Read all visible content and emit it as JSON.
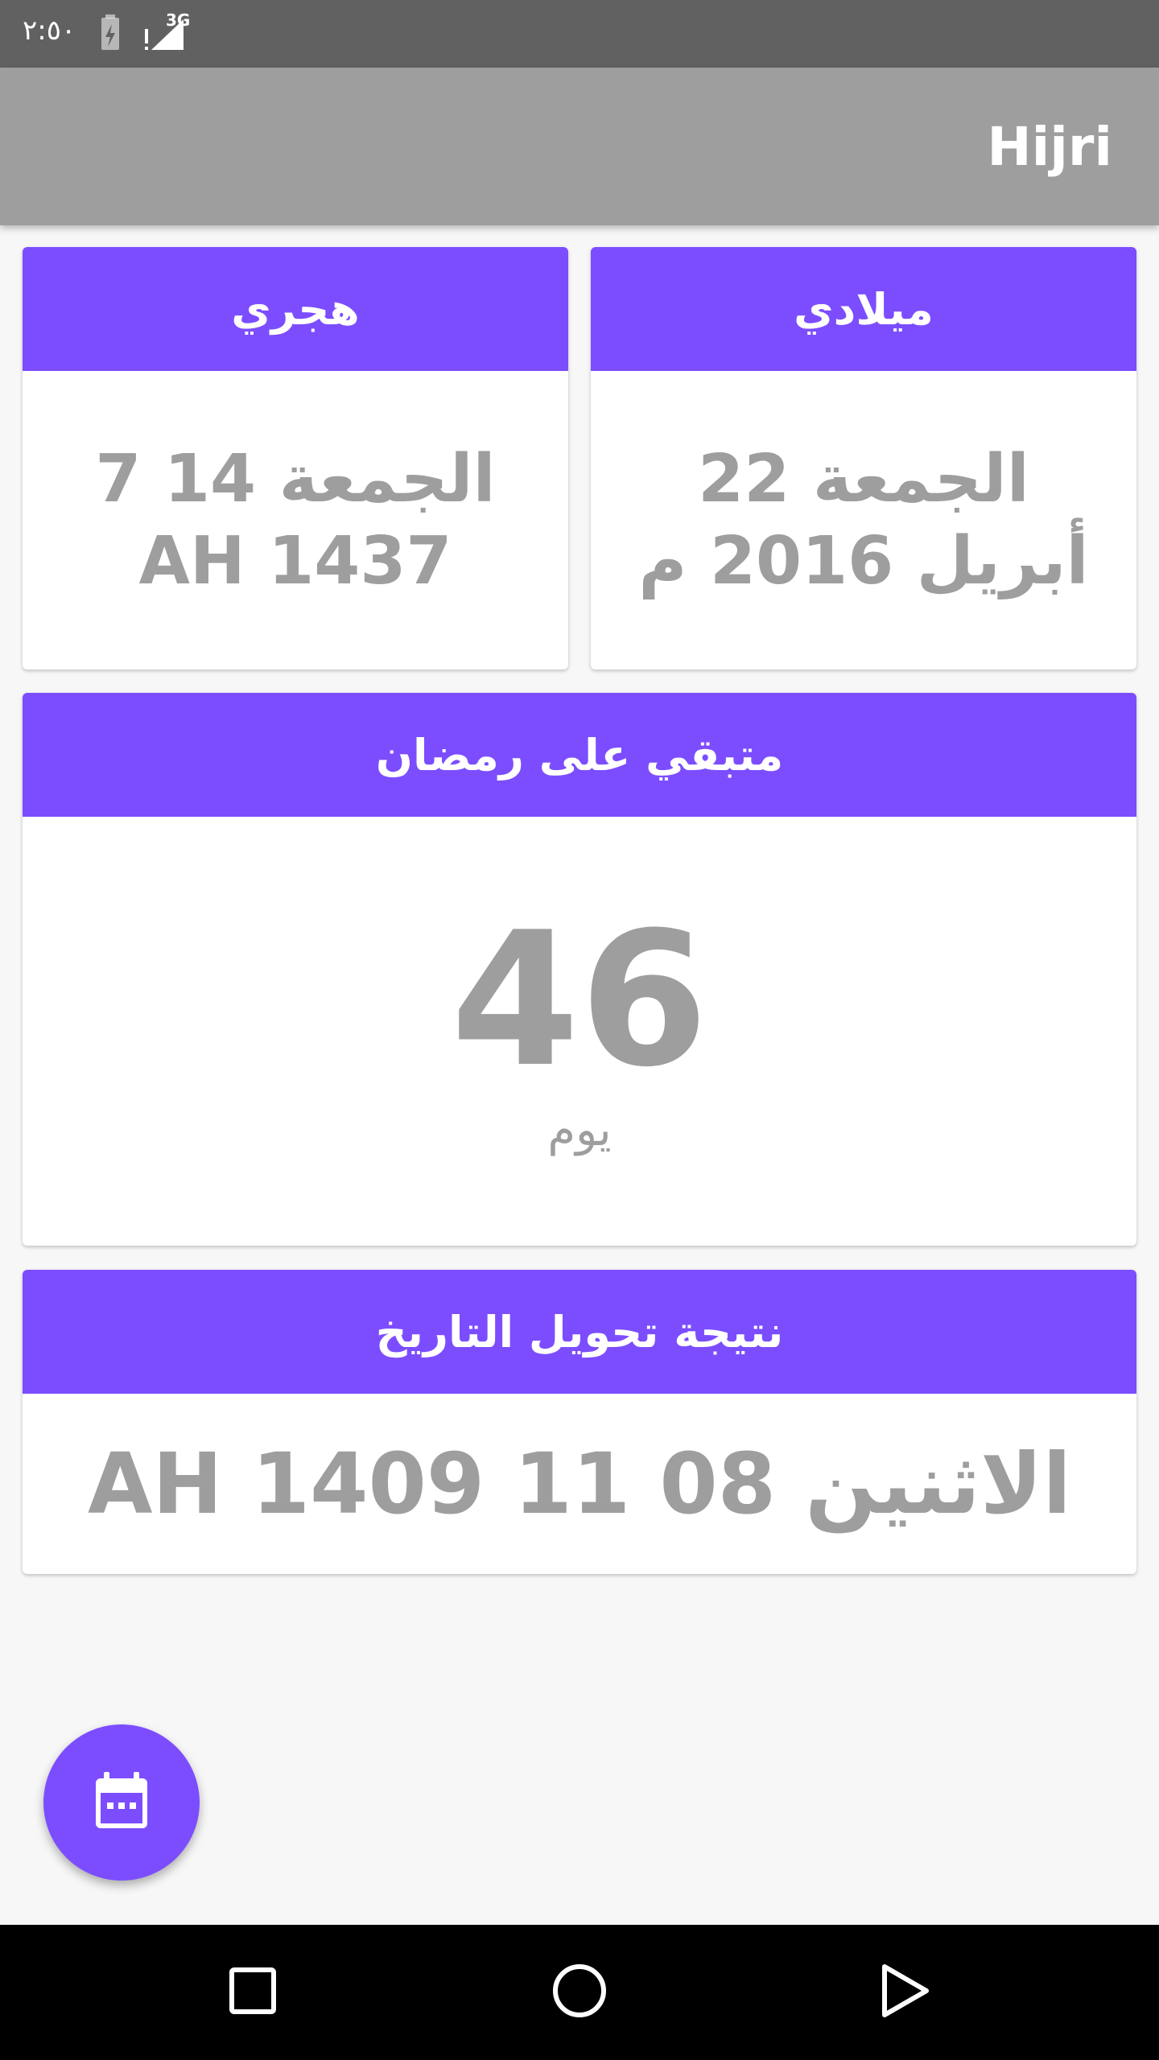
{
  "status_bar": {
    "time": "٢:٥٠",
    "network": "3G",
    "icons": [
      "battery-charging-icon",
      "signal-3g-icon"
    ]
  },
  "app_bar": {
    "title": "Hijri"
  },
  "gregorian_card": {
    "header": "ميلادي",
    "date": "الجمعة 22 أبريل 2016 م"
  },
  "hijri_card": {
    "header": "هجري",
    "date": "الجمعة 14 7 1437 AH"
  },
  "ramadan_card": {
    "header": "متبقي على رمضان",
    "days": "46",
    "unit": "يوم"
  },
  "conversion_card": {
    "header": "نتيجة تحويل التاريخ",
    "result": "الاثنين 08 11 1409 AH"
  },
  "fab": {
    "icon": "calendar-icon"
  },
  "nav_bar": {
    "icons": [
      "recents-square-icon",
      "home-circle-icon",
      "back-triangle-icon"
    ]
  },
  "colors": {
    "accent": "#7c4dff",
    "app_bar": "#9e9e9e",
    "status_bar": "#616161",
    "text_gray": "#9e9e9e",
    "background": "#f7f7f7"
  }
}
